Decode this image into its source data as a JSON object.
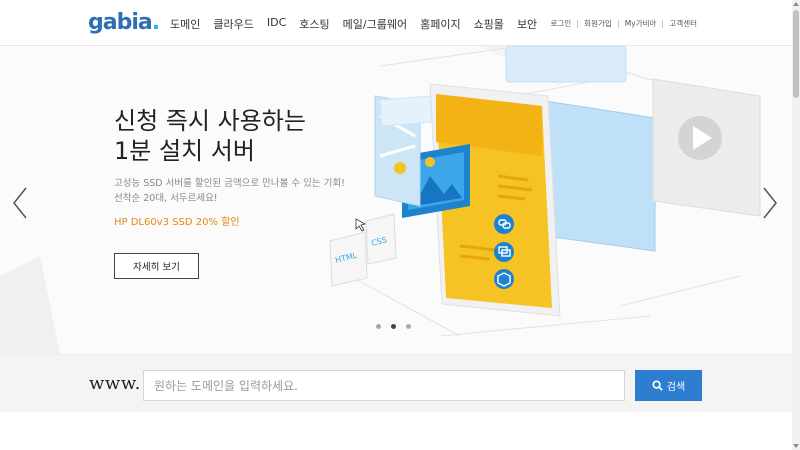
{
  "header": {
    "logo": "gabia",
    "logo_dot": ".",
    "nav": [
      "도메인",
      "클라우드",
      "IDC",
      "호스팅",
      "메일/그룹웨어",
      "홈페이지",
      "쇼핑몰",
      "보안"
    ],
    "util": [
      "로그인",
      "회원가입",
      "My가비아",
      "고객센터"
    ]
  },
  "hero": {
    "title_line1": "신청 즉시 사용하는",
    "title_line2": "1분 설치 서버",
    "desc_line1": "고성능 SSD 서버를 할인된 금액으로 만나볼 수 있는 기회!",
    "desc_line2": "선착순 20대, 서두르세요!",
    "promo": "HP DL60v3 SSD 20% 할인",
    "button": "자세히 보기",
    "illus_labels": {
      "html": "HTML",
      "css": "CSS"
    }
  },
  "search": {
    "prefix": "www.",
    "placeholder": "원하는 도메인을 입력하세요.",
    "button": "검색"
  },
  "colors": {
    "brand_blue": "#2e6fb4",
    "accent_orange": "#e28a17",
    "search_button": "#2d7ed1",
    "illus_yellow": "#f6c324"
  },
  "icons": [
    "chevron-left-icon",
    "chevron-right-icon",
    "search-icon",
    "play-icon",
    "link-icon",
    "layers-icon",
    "cube-icon",
    "image-icon"
  ]
}
